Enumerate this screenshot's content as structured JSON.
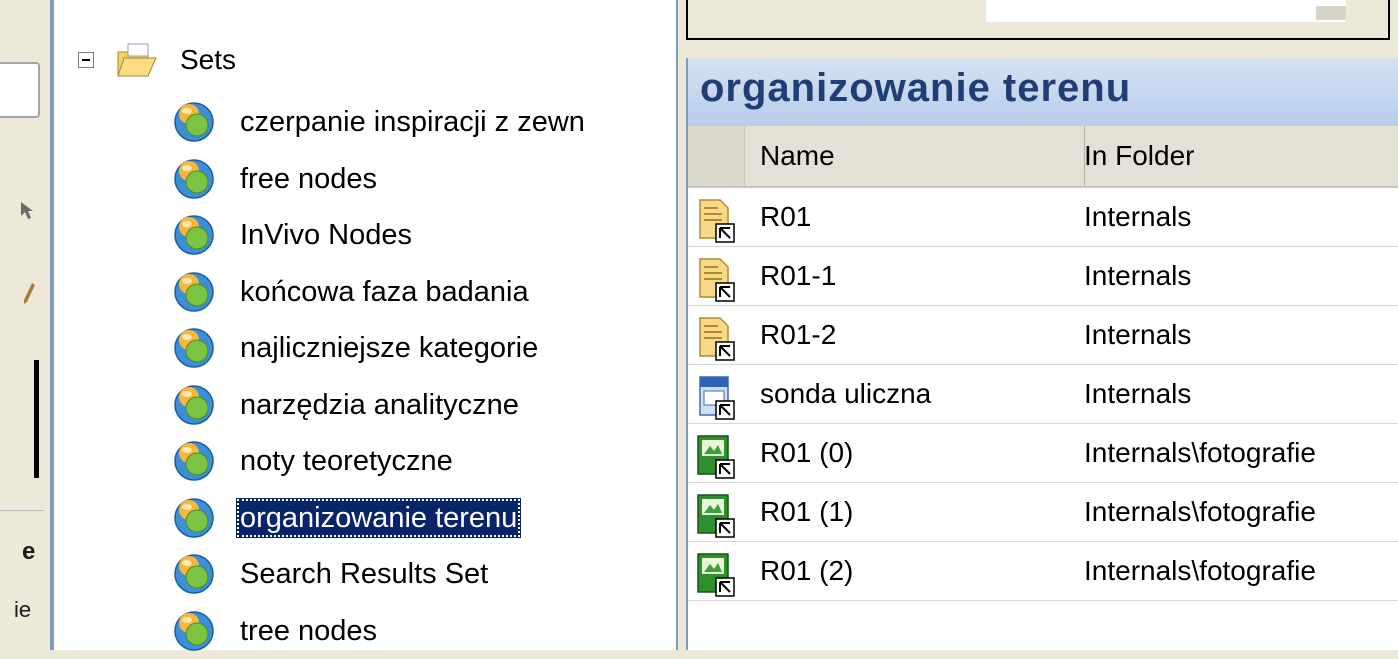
{
  "tree": {
    "root_label": "Sets",
    "items": [
      {
        "label": "czerpanie inspiracji z zewn",
        "selected": false
      },
      {
        "label": "free nodes",
        "selected": false
      },
      {
        "label": "InVivo Nodes",
        "selected": false
      },
      {
        "label": "końcowa faza badania",
        "selected": false
      },
      {
        "label": "najliczniejsze kategorie",
        "selected": false
      },
      {
        "label": "narzędzia analityczne",
        "selected": false
      },
      {
        "label": "noty teoretyczne",
        "selected": false
      },
      {
        "label": "organizowanie terenu",
        "selected": true
      },
      {
        "label": "Search Results Set",
        "selected": false
      },
      {
        "label": "tree nodes",
        "selected": false
      }
    ]
  },
  "left_strip": {
    "text1": "e",
    "text2": "ie"
  },
  "view": {
    "title": "organizowanie terenu",
    "columns": {
      "name": "Name",
      "folder": "In Folder"
    },
    "rows": [
      {
        "name": "R01",
        "folder": "Internals",
        "icon": "document-shortcut-icon"
      },
      {
        "name": "R01-1",
        "folder": "Internals",
        "icon": "document-shortcut-icon"
      },
      {
        "name": "R01-2",
        "folder": "Internals",
        "icon": "document-shortcut-icon"
      },
      {
        "name": "sonda uliczna",
        "folder": "Internals",
        "icon": "media-shortcut-icon"
      },
      {
        "name": "R01 (0)",
        "folder": "Internals\\fotografie",
        "icon": "picture-shortcut-icon"
      },
      {
        "name": "R01 (1)",
        "folder": "Internals\\fotografie",
        "icon": "picture-shortcut-icon"
      },
      {
        "name": "R01 (2)",
        "folder": "Internals\\fotografie",
        "icon": "picture-shortcut-icon"
      }
    ]
  },
  "colors": {
    "selection": "#0a246a",
    "title_text": "#1f3f74",
    "title_band": "#c6d7ee"
  }
}
